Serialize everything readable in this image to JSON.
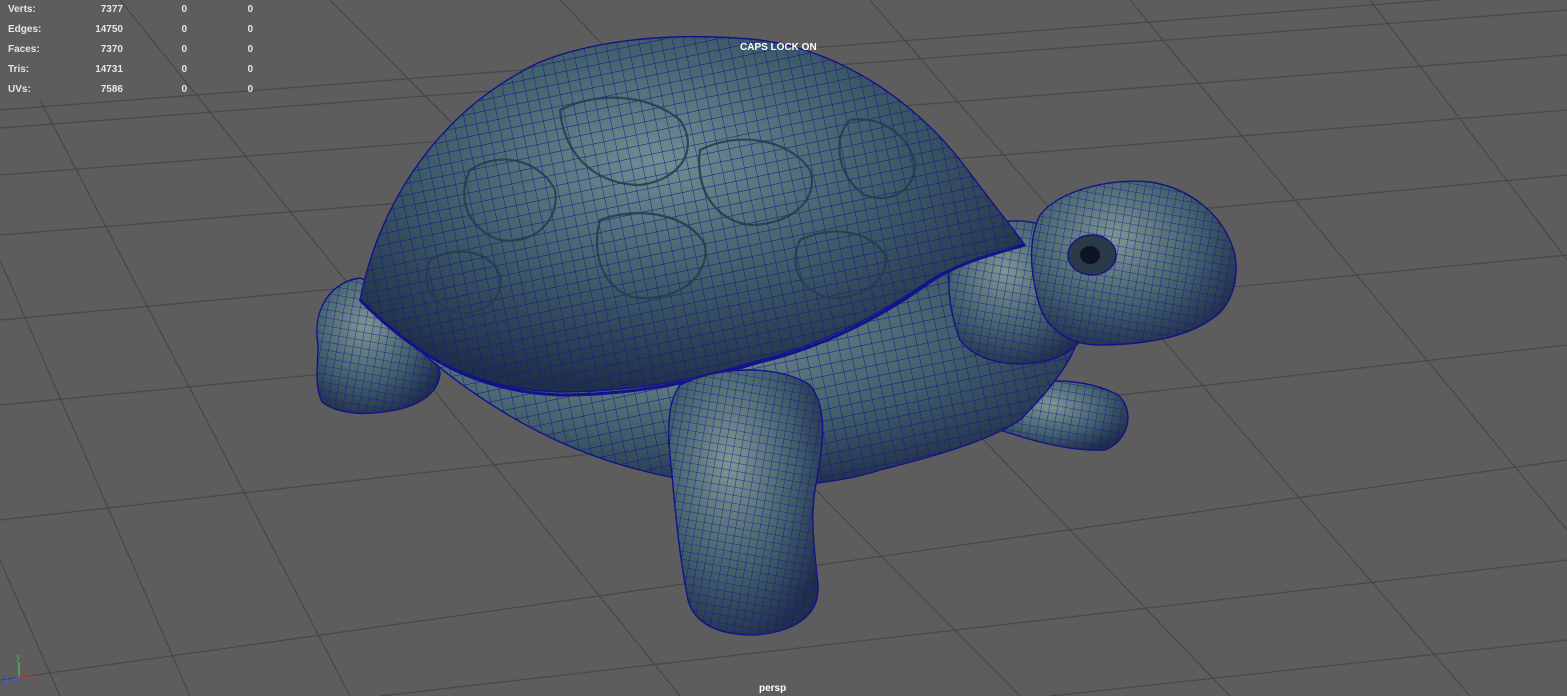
{
  "hud": {
    "rows": [
      {
        "label": "Verts:",
        "total": "7377",
        "selected": "0",
        "component": "0"
      },
      {
        "label": "Edges:",
        "total": "14750",
        "selected": "0",
        "component": "0"
      },
      {
        "label": "Faces:",
        "total": "7370",
        "selected": "0",
        "component": "0"
      },
      {
        "label": "Tris:",
        "total": "14731",
        "selected": "0",
        "component": "0"
      },
      {
        "label": "UVs:",
        "total": "7586",
        "selected": "0",
        "component": "0"
      }
    ]
  },
  "status": {
    "caps_lock": "CAPS LOCK ON"
  },
  "camera": {
    "name": "persp"
  },
  "axis": {
    "x": "x",
    "y": "y",
    "z": "z"
  },
  "colors": {
    "background": "#5d5d5d",
    "grid": "#454545",
    "wireframe": "#1a1a8a",
    "axis_x": "#d32f2f",
    "axis_y": "#4caf50",
    "axis_z": "#3d5afe"
  }
}
